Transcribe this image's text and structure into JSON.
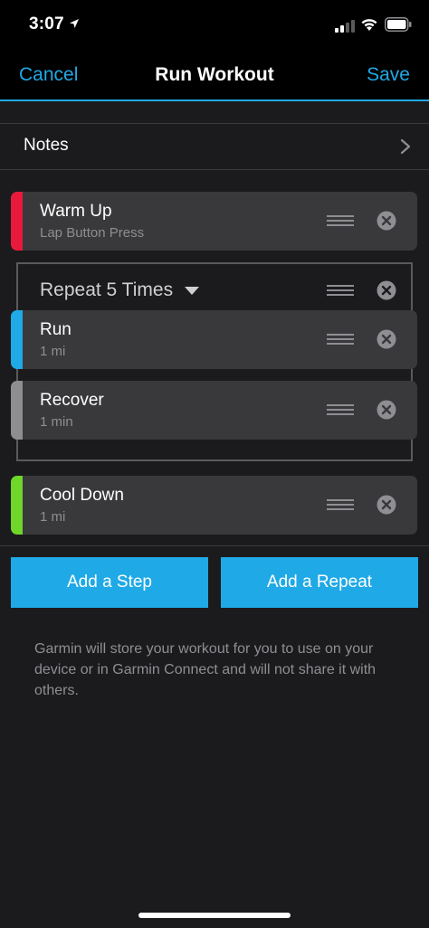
{
  "status_bar": {
    "time": "3:07"
  },
  "nav": {
    "cancel_label": "Cancel",
    "title": "Run Workout",
    "save_label": "Save"
  },
  "notes": {
    "label": "Notes"
  },
  "steps": [
    {
      "title": "Warm Up",
      "subtitle": "Lap Button Press",
      "color": "#e8193c"
    },
    {
      "title": "Run",
      "subtitle": "1 mi",
      "color": "#1fa9e6"
    },
    {
      "title": "Recover",
      "subtitle": "1 min",
      "color": "#8e8e90"
    },
    {
      "title": "Cool Down",
      "subtitle": "1 mi",
      "color": "#6fd62a"
    }
  ],
  "repeat": {
    "label": "Repeat 5 Times"
  },
  "buttons": {
    "add_step": "Add a Step",
    "add_repeat": "Add a Repeat"
  },
  "info_text": "Garmin will store your workout for you to use on your device or in Garmin Connect and will not share it with others.",
  "colors": {
    "accent": "#1fa9e6",
    "background": "#1b1b1d",
    "card": "#39393b"
  },
  "icons": [
    "location-arrow-icon",
    "signal-icon",
    "wifi-icon",
    "battery-icon",
    "chevron-right-icon",
    "drag-handle-icon",
    "remove-icon",
    "caret-down-icon"
  ]
}
